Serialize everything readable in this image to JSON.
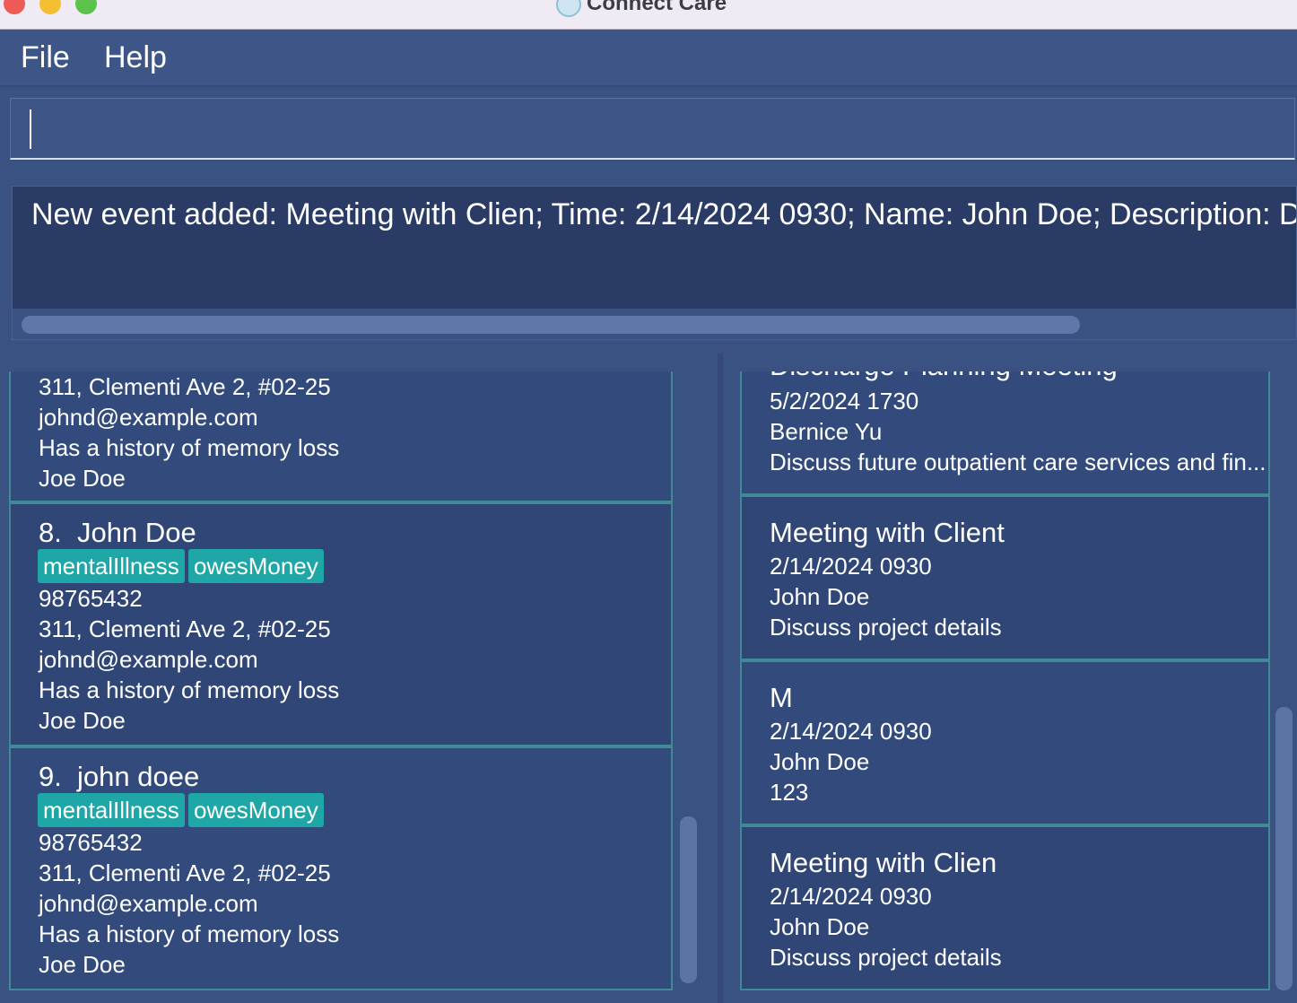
{
  "window": {
    "title": "Connect Care"
  },
  "menu": {
    "file": "File",
    "help": "Help"
  },
  "command": {
    "value": "",
    "placeholder": ""
  },
  "result": {
    "message": "New event added: Meeting with Clien; Time: 2/14/2024 0930; Name: John Doe; Description: Discuss project details"
  },
  "persons": {
    "partial": {
      "address": "311, Clementi Ave 2, #02-25",
      "email": "johnd@example.com",
      "remark": "Has a history of memory loss",
      "contact": "Joe Doe"
    },
    "items": [
      {
        "index": "8.",
        "name": "John Doe",
        "tags": [
          "mentalIllness",
          "owesMoney"
        ],
        "phone": "98765432",
        "address": "311, Clementi Ave 2, #02-25",
        "email": "johnd@example.com",
        "remark": "Has a history of memory loss",
        "contact": "Joe Doe"
      },
      {
        "index": "9.",
        "name": "john doee",
        "tags": [
          "mentalIllness",
          "owesMoney"
        ],
        "phone": "98765432",
        "address": "311, Clementi Ave 2, #02-25",
        "email": "johnd@example.com",
        "remark": "Has a history of memory loss",
        "contact": "Joe Doe"
      }
    ]
  },
  "events": {
    "partial": {
      "title": "Discharge Planning Meeting",
      "time": "5/2/2024 1730",
      "name": "Bernice Yu",
      "description": "Discuss future outpatient care services and fin..."
    },
    "items": [
      {
        "title": "Meeting with Client",
        "time": "2/14/2024 0930",
        "name": "John Doe",
        "description": "Discuss project details"
      },
      {
        "title": "M",
        "time": "2/14/2024 0930",
        "name": "John Doe",
        "description": "123"
      },
      {
        "title": "Meeting with Clien",
        "time": "2/14/2024 0930",
        "name": "John Doe",
        "description": "Discuss project details"
      }
    ]
  }
}
